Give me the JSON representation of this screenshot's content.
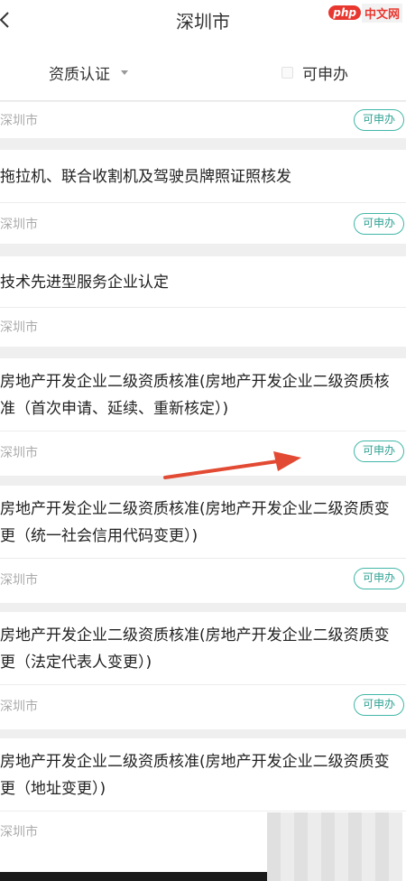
{
  "header": {
    "title": "深圳市",
    "watermark_php": "php",
    "watermark_site": "中文网"
  },
  "filters": {
    "category": "资质认证",
    "checkbox_label": "可申办"
  },
  "cards": [
    {
      "title": "",
      "city": "深圳市",
      "badge": "可申办"
    },
    {
      "title": "拖拉机、联合收割机及驾驶员牌照证照核发",
      "city": "深圳市",
      "badge": "可申办"
    },
    {
      "title": "技术先进型服务企业认定",
      "city": "深圳市",
      "badge": ""
    },
    {
      "title": "房地产开发企业二级资质核准(房地产开发企业二级资质核准（首次申请、延续、重新核定）)",
      "city": "深圳市",
      "badge": "可申办"
    },
    {
      "title": "房地产开发企业二级资质核准(房地产开发企业二级资质变更（统一社会信用代码变更）)",
      "city": "深圳市",
      "badge": "可申办"
    },
    {
      "title": "房地产开发企业二级资质核准(房地产开发企业二级资质变更（法定代表人变更）)",
      "city": "深圳市",
      "badge": "可申办"
    },
    {
      "title": "房地产开发企业二级资质核准(房地产开发企业二级资质变更（地址变更）)",
      "city": "深圳市",
      "badge": ""
    }
  ],
  "colors": {
    "accent": "#41b7a8",
    "arrow": "#e24a33",
    "watermark_red": "#e8372f"
  }
}
